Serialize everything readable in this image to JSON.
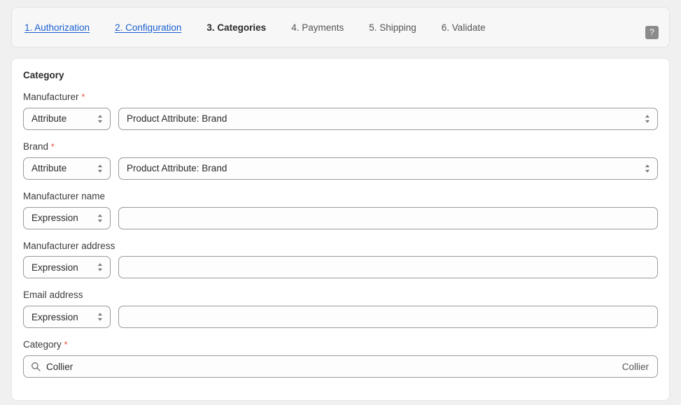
{
  "wizard": {
    "tabs": [
      {
        "label": "1. Authorization",
        "state": "link"
      },
      {
        "label": "2. Configuration",
        "state": "link"
      },
      {
        "label": "3. Categories",
        "state": "active"
      },
      {
        "label": "4. Payments",
        "state": "inactive"
      },
      {
        "label": "5. Shipping",
        "state": "inactive"
      },
      {
        "label": "6. Validate",
        "state": "inactive"
      }
    ],
    "help_label": "?"
  },
  "section": {
    "title": "Category"
  },
  "fields": {
    "manufacturer": {
      "label": "Manufacturer",
      "required": "*",
      "type_value": "Attribute",
      "value": "Product Attribute: Brand"
    },
    "brand": {
      "label": "Brand",
      "required": "*",
      "type_value": "Attribute",
      "value": "Product Attribute: Brand"
    },
    "manufacturer_name": {
      "label": "Manufacturer name",
      "type_value": "Expression",
      "value": "",
      "placeholder": ""
    },
    "manufacturer_address": {
      "label": "Manufacturer address",
      "type_value": "Expression",
      "value": "",
      "placeholder": ""
    },
    "email_address": {
      "label": "Email address",
      "type_value": "Expression",
      "value": "",
      "placeholder": ""
    },
    "category": {
      "label": "Category",
      "required": "*",
      "value": "Collier",
      "placeholder": "",
      "selected_hint": "Collier"
    }
  },
  "icons": {
    "help": "question-mark-icon",
    "select_chevron": "chevron-up-down-icon",
    "search": "search-icon"
  },
  "colors": {
    "link": "#1a5fd0",
    "required": "#e8553e",
    "page_background": "#f0f0f0",
    "card_background": "#ffffff",
    "tabbar_background": "#f7f7f7",
    "help_button": "#8b8b8b"
  }
}
